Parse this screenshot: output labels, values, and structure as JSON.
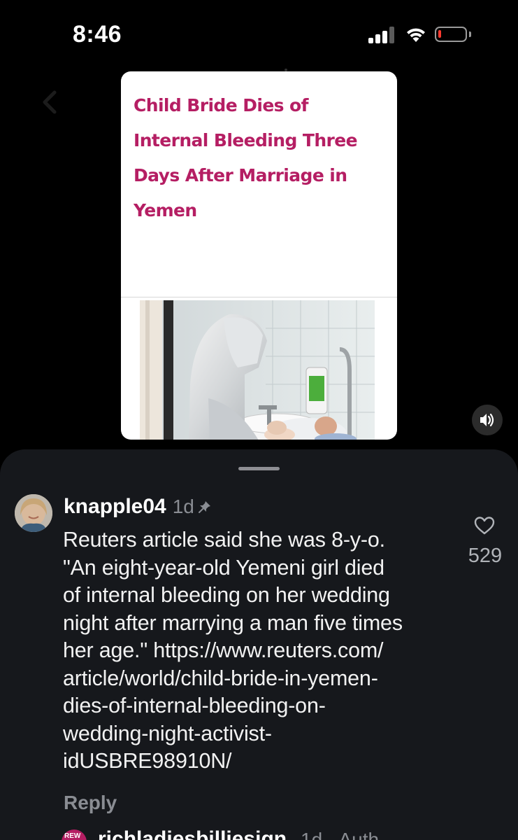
{
  "status_bar": {
    "time": "8:46",
    "battery_level": 0.12,
    "signal_bars": 3,
    "battery_color": "#ff3b30"
  },
  "video": {
    "headline_lines": [
      "Child Bride Dies of",
      "Internal Bleeding Three",
      "Days After Marriage in",
      "Yemen"
    ],
    "headline_color": "#b51e63",
    "volume_icon": "speaker-on-icon"
  },
  "comment": {
    "username": "knapple04",
    "timestamp": "1d",
    "pinned_icon": "pin-icon",
    "body_lines": [
      "Reuters article said she was 8-y-o.",
      "\"An eight-year-old Yemeni girl died",
      "of internal bleeding on her wedding",
      "night after marrying a man five times",
      "her age.\" https://www.reuters.com/",
      "article/world/child-bride-in-yemen-",
      "dies-of-internal-bleeding-on-",
      "wedding-night-activist-",
      "idUSBRE98910N/"
    ],
    "reply_label": "Reply",
    "like_icon": "heart-outline-icon",
    "like_count": "529"
  },
  "next_comment": {
    "username": "richladiesbilliesign",
    "meta": "1d · Auth"
  }
}
